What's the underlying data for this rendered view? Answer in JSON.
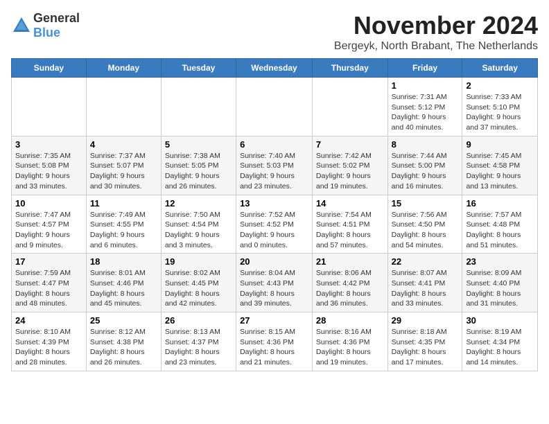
{
  "header": {
    "logo_general": "General",
    "logo_blue": "Blue",
    "month_title": "November 2024",
    "location": "Bergeyk, North Brabant, The Netherlands"
  },
  "weekdays": [
    "Sunday",
    "Monday",
    "Tuesday",
    "Wednesday",
    "Thursday",
    "Friday",
    "Saturday"
  ],
  "weeks": [
    [
      {
        "day": "",
        "info": ""
      },
      {
        "day": "",
        "info": ""
      },
      {
        "day": "",
        "info": ""
      },
      {
        "day": "",
        "info": ""
      },
      {
        "day": "",
        "info": ""
      },
      {
        "day": "1",
        "info": "Sunrise: 7:31 AM\nSunset: 5:12 PM\nDaylight: 9 hours and 40 minutes."
      },
      {
        "day": "2",
        "info": "Sunrise: 7:33 AM\nSunset: 5:10 PM\nDaylight: 9 hours and 37 minutes."
      }
    ],
    [
      {
        "day": "3",
        "info": "Sunrise: 7:35 AM\nSunset: 5:08 PM\nDaylight: 9 hours and 33 minutes."
      },
      {
        "day": "4",
        "info": "Sunrise: 7:37 AM\nSunset: 5:07 PM\nDaylight: 9 hours and 30 minutes."
      },
      {
        "day": "5",
        "info": "Sunrise: 7:38 AM\nSunset: 5:05 PM\nDaylight: 9 hours and 26 minutes."
      },
      {
        "day": "6",
        "info": "Sunrise: 7:40 AM\nSunset: 5:03 PM\nDaylight: 9 hours and 23 minutes."
      },
      {
        "day": "7",
        "info": "Sunrise: 7:42 AM\nSunset: 5:02 PM\nDaylight: 9 hours and 19 minutes."
      },
      {
        "day": "8",
        "info": "Sunrise: 7:44 AM\nSunset: 5:00 PM\nDaylight: 9 hours and 16 minutes."
      },
      {
        "day": "9",
        "info": "Sunrise: 7:45 AM\nSunset: 4:58 PM\nDaylight: 9 hours and 13 minutes."
      }
    ],
    [
      {
        "day": "10",
        "info": "Sunrise: 7:47 AM\nSunset: 4:57 PM\nDaylight: 9 hours and 9 minutes."
      },
      {
        "day": "11",
        "info": "Sunrise: 7:49 AM\nSunset: 4:55 PM\nDaylight: 9 hours and 6 minutes."
      },
      {
        "day": "12",
        "info": "Sunrise: 7:50 AM\nSunset: 4:54 PM\nDaylight: 9 hours and 3 minutes."
      },
      {
        "day": "13",
        "info": "Sunrise: 7:52 AM\nSunset: 4:52 PM\nDaylight: 9 hours and 0 minutes."
      },
      {
        "day": "14",
        "info": "Sunrise: 7:54 AM\nSunset: 4:51 PM\nDaylight: 8 hours and 57 minutes."
      },
      {
        "day": "15",
        "info": "Sunrise: 7:56 AM\nSunset: 4:50 PM\nDaylight: 8 hours and 54 minutes."
      },
      {
        "day": "16",
        "info": "Sunrise: 7:57 AM\nSunset: 4:48 PM\nDaylight: 8 hours and 51 minutes."
      }
    ],
    [
      {
        "day": "17",
        "info": "Sunrise: 7:59 AM\nSunset: 4:47 PM\nDaylight: 8 hours and 48 minutes."
      },
      {
        "day": "18",
        "info": "Sunrise: 8:01 AM\nSunset: 4:46 PM\nDaylight: 8 hours and 45 minutes."
      },
      {
        "day": "19",
        "info": "Sunrise: 8:02 AM\nSunset: 4:45 PM\nDaylight: 8 hours and 42 minutes."
      },
      {
        "day": "20",
        "info": "Sunrise: 8:04 AM\nSunset: 4:43 PM\nDaylight: 8 hours and 39 minutes."
      },
      {
        "day": "21",
        "info": "Sunrise: 8:06 AM\nSunset: 4:42 PM\nDaylight: 8 hours and 36 minutes."
      },
      {
        "day": "22",
        "info": "Sunrise: 8:07 AM\nSunset: 4:41 PM\nDaylight: 8 hours and 33 minutes."
      },
      {
        "day": "23",
        "info": "Sunrise: 8:09 AM\nSunset: 4:40 PM\nDaylight: 8 hours and 31 minutes."
      }
    ],
    [
      {
        "day": "24",
        "info": "Sunrise: 8:10 AM\nSunset: 4:39 PM\nDaylight: 8 hours and 28 minutes."
      },
      {
        "day": "25",
        "info": "Sunrise: 8:12 AM\nSunset: 4:38 PM\nDaylight: 8 hours and 26 minutes."
      },
      {
        "day": "26",
        "info": "Sunrise: 8:13 AM\nSunset: 4:37 PM\nDaylight: 8 hours and 23 minutes."
      },
      {
        "day": "27",
        "info": "Sunrise: 8:15 AM\nSunset: 4:36 PM\nDaylight: 8 hours and 21 minutes."
      },
      {
        "day": "28",
        "info": "Sunrise: 8:16 AM\nSunset: 4:36 PM\nDaylight: 8 hours and 19 minutes."
      },
      {
        "day": "29",
        "info": "Sunrise: 8:18 AM\nSunset: 4:35 PM\nDaylight: 8 hours and 17 minutes."
      },
      {
        "day": "30",
        "info": "Sunrise: 8:19 AM\nSunset: 4:34 PM\nDaylight: 8 hours and 14 minutes."
      }
    ]
  ]
}
